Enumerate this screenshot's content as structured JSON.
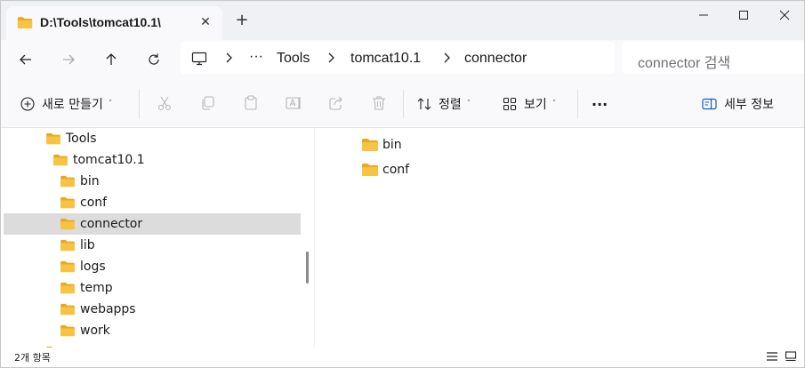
{
  "tab": {
    "title": "D:\\Tools\\tomcat10.1\\",
    "close_glyph": "✕",
    "new_tab_glyph": "+"
  },
  "window_controls": [
    "minimize-icon",
    "maximize-icon",
    "close-icon"
  ],
  "address": {
    "overflow": "···",
    "crumbs": [
      "Tools",
      "tomcat10.1",
      "connector"
    ]
  },
  "search": {
    "placeholder": "connector 검색"
  },
  "commands": {
    "new": "새로 만들기",
    "sort": "정렬",
    "view": "보기",
    "more": "···",
    "details": "세부 정보",
    "dropdown_glyph": "˅"
  },
  "tree": [
    {
      "label": "Tools",
      "level": 0
    },
    {
      "label": "tomcat10.1",
      "level": 1
    },
    {
      "label": "bin",
      "level": 2
    },
    {
      "label": "conf",
      "level": 2
    },
    {
      "label": "connector",
      "level": 2,
      "selected": true
    },
    {
      "label": "lib",
      "level": 2
    },
    {
      "label": "logs",
      "level": 2
    },
    {
      "label": "temp",
      "level": 2
    },
    {
      "label": "webapps",
      "level": 2
    },
    {
      "label": "work",
      "level": 2
    }
  ],
  "content": [
    "bin",
    "conf"
  ],
  "status": {
    "item_count": "2개 항목"
  },
  "colors": {
    "folder": "#f6c343",
    "folder_dark": "#e8a91d",
    "selection": "#dcdcdc",
    "chrome": "#eff1f5"
  }
}
